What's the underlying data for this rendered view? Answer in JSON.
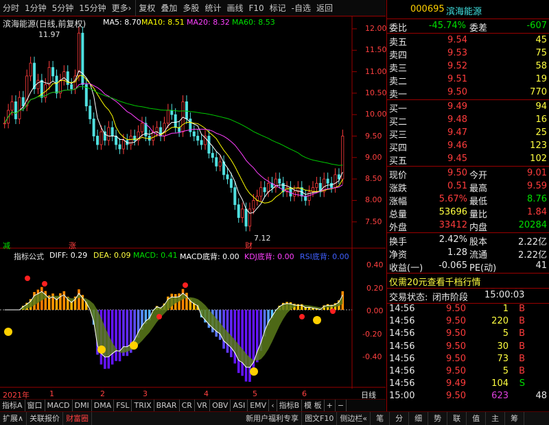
{
  "toolbar": {
    "items": [
      "分时",
      "1分钟",
      "5分钟",
      "15分钟",
      "更多›",
      "复权",
      "叠加",
      "多股",
      "统计",
      "画线",
      "F10",
      "标记",
      "-自选",
      "返回"
    ]
  },
  "main_chart": {
    "stock_label": "滨海能源(日线,前复权)",
    "ma": [
      {
        "label": "MA5: 8.70",
        "color": "#ffffff"
      },
      {
        "label": "MA10: 8.51",
        "color": "#ffff00"
      },
      {
        "label": "MA20: 8.32",
        "color": "#ff40ff"
      },
      {
        "label": "MA60: 8.53",
        "color": "#00e000"
      }
    ],
    "price_ticks": [
      "12.00",
      "11.50",
      "11.00",
      "10.50",
      "10.00",
      "9.50",
      "9.00",
      "8.50",
      "8.00",
      "7.50"
    ],
    "high_annotation": "11.97",
    "low_annotation": "7.12",
    "marker_jian": "减",
    "marker_zhang": "涨",
    "marker_cai": "财"
  },
  "indicator": {
    "title": "指标公式",
    "diff": "DIFF: 0.29",
    "dea": "DEA: 0.09",
    "macd": "MACD: 0.41",
    "macd_div": "MACD底背: 0.00",
    "kdj_div": "KDJ底背: 0.00",
    "rsi_div": "RSI底背: 0.00",
    "ticks": [
      "0.40",
      "0.20",
      "0.00",
      "-0.20",
      "-0.40"
    ]
  },
  "time_axis": {
    "labels": [
      "2021年",
      "1",
      "2",
      "3",
      "4",
      "5",
      "6"
    ],
    "period": "日线"
  },
  "bottom_tabs": [
    "指标A",
    "窗口",
    "MACD",
    "DMI",
    "DMA",
    "FSL",
    "TRIX",
    "BRAR",
    "CR",
    "VR",
    "OBV",
    "ASI",
    "EMV",
    "‹",
    "指标B",
    "模 板",
    "+",
    "−"
  ],
  "status_bar": [
    "扩展∧",
    "关联报价",
    "财富圈",
    "新用户福利专享",
    "图文F10",
    "侧边栏«",
    "笔",
    "分",
    "细",
    "势",
    "联",
    "值",
    "主",
    "筹"
  ],
  "quote": {
    "code": "000695",
    "name": "滨海能源",
    "weibi_label": "委比",
    "weibi": "-45.74%",
    "weicha_label": "委差",
    "weicha": "-607",
    "asks": [
      {
        "label": "卖五",
        "price": "9.54",
        "vol": "45"
      },
      {
        "label": "卖四",
        "price": "9.53",
        "vol": "75"
      },
      {
        "label": "卖三",
        "price": "9.52",
        "vol": "58"
      },
      {
        "label": "卖二",
        "price": "9.51",
        "vol": "19"
      },
      {
        "label": "卖一",
        "price": "9.50",
        "vol": "770"
      }
    ],
    "bids": [
      {
        "label": "买一",
        "price": "9.49",
        "vol": "94"
      },
      {
        "label": "买二",
        "price": "9.48",
        "vol": "16"
      },
      {
        "label": "买三",
        "price": "9.47",
        "vol": "25"
      },
      {
        "label": "买四",
        "price": "9.46",
        "vol": "123"
      },
      {
        "label": "买五",
        "price": "9.45",
        "vol": "102"
      }
    ],
    "stats": [
      {
        "l1": "现价",
        "v1": "9.50",
        "c1": "red",
        "l2": "今开",
        "v2": "9.01",
        "c2": "red"
      },
      {
        "l1": "涨跌",
        "v1": "0.51",
        "c1": "red",
        "l2": "最高",
        "v2": "9.59",
        "c2": "red"
      },
      {
        "l1": "涨幅",
        "v1": "5.67%",
        "c1": "red",
        "l2": "最低",
        "v2": "8.76",
        "c2": "green"
      },
      {
        "l1": "总量",
        "v1": "53696",
        "c1": "yellow",
        "l2": "量比",
        "v2": "1.84",
        "c2": "red"
      },
      {
        "l1": "外盘",
        "v1": "33412",
        "c1": "red",
        "l2": "内盘",
        "v2": "20284",
        "c2": "green"
      }
    ],
    "stats2": [
      {
        "l1": "换手",
        "v1": "2.42%",
        "l2": "股本",
        "v2": "2.22亿"
      },
      {
        "l1": "净资",
        "v1": "1.28",
        "l2": "流通",
        "v2": "2.22亿"
      },
      {
        "l1": "收益(一)",
        "v1": "-0.065",
        "l2": "PE(动)",
        "v2": "41"
      }
    ],
    "promo": "仅需20元查看千档行情",
    "trade_status_label": "交易状态:",
    "trade_status": "闭市阶段",
    "trade_time": "15:00:03",
    "ticks": [
      {
        "t": "14:56",
        "p": "9.50",
        "v": "1",
        "s": "B"
      },
      {
        "t": "14:56",
        "p": "9.50",
        "v": "220",
        "s": "B"
      },
      {
        "t": "14:56",
        "p": "9.50",
        "v": "5",
        "s": "B"
      },
      {
        "t": "14:56",
        "p": "9.50",
        "v": "30",
        "s": "B"
      },
      {
        "t": "14:56",
        "p": "9.50",
        "v": "73",
        "s": "B"
      },
      {
        "t": "14:56",
        "p": "9.50",
        "v": "5",
        "s": "B"
      },
      {
        "t": "14:56",
        "p": "9.49",
        "v": "104",
        "s": "S"
      },
      {
        "t": "15:00",
        "p": "9.50",
        "v": "623",
        "s": "",
        "extra": "48"
      }
    ]
  }
}
